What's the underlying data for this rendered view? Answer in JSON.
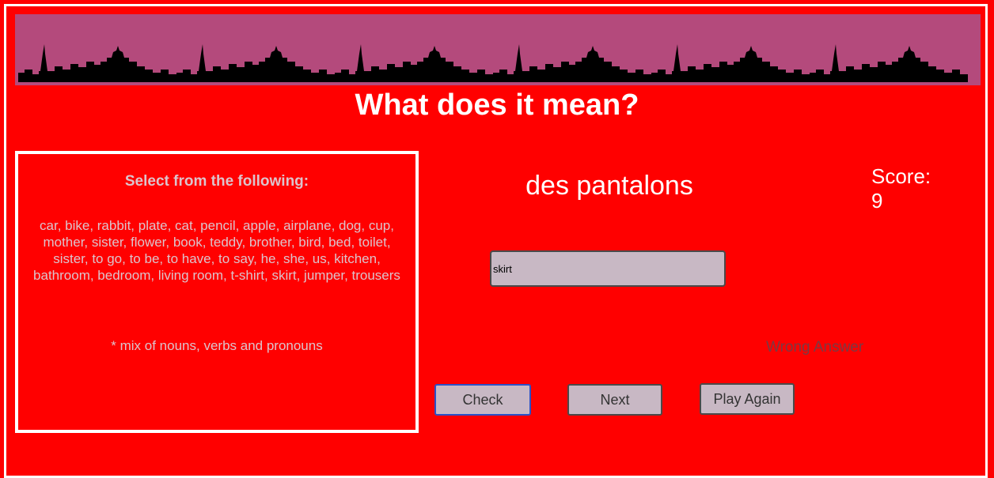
{
  "header": {
    "title": "What does it mean?"
  },
  "word_panel": {
    "heading": "Select from the following:",
    "words": "car, bike, rabbit, plate, cat, pencil, apple, airplane, dog, cup, mother, sister, flower, book, teddy, brother, bird, bed, toilet, sister, to go, to be, to have, to say, he, she, us, kitchen, bathroom, bedroom, living room, t-shirt, skirt, jumper, trousers",
    "note": "* mix of nouns, verbs and pronouns"
  },
  "quiz": {
    "french_word": "des pantalons",
    "score_label": "Score:",
    "score_value": "9",
    "answer_value": "skirt",
    "feedback": "Wrong Answer"
  },
  "buttons": {
    "check": "Check",
    "next": "Next",
    "play_again": "Play Again"
  },
  "colors": {
    "background": "#ff0000",
    "banner": "#b44a7c",
    "skyline": "#000000",
    "panel_text": "#dcc4cc"
  },
  "icons": {
    "banner_image": "paris-skyline-silhouette"
  }
}
